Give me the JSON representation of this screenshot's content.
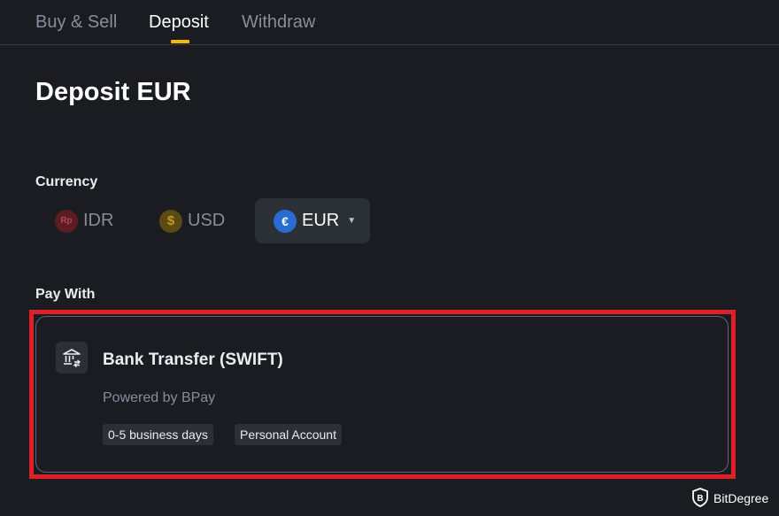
{
  "tabs": [
    {
      "label": "Buy & Sell",
      "active": false
    },
    {
      "label": "Deposit",
      "active": true
    },
    {
      "label": "Withdraw",
      "active": false
    }
  ],
  "colors": {
    "background": "#1b1c22",
    "accent": "#f0b90b",
    "highlight": "#e02026",
    "muted_text": "#848e9c"
  },
  "page_title": "Deposit EUR",
  "currency": {
    "label": "Currency",
    "options": [
      {
        "code": "IDR",
        "icon": "rupiah-coin-icon",
        "icon_glyph": "Rp",
        "selected": false
      },
      {
        "code": "USD",
        "icon": "dollar-coin-icon",
        "icon_glyph": "$",
        "selected": false
      },
      {
        "code": "EUR",
        "icon": "euro-coin-icon",
        "icon_glyph": "€",
        "selected": true
      }
    ]
  },
  "pay_with": {
    "label": "Pay With",
    "method": {
      "icon": "bank-icon",
      "title": "Bank Transfer (SWIFT)",
      "provider": "Powered by BPay",
      "tags": [
        "0-5 business days",
        "Personal Account"
      ]
    }
  },
  "watermark": {
    "text": "BitDegree",
    "icon": "bitdegree-shield-icon"
  }
}
